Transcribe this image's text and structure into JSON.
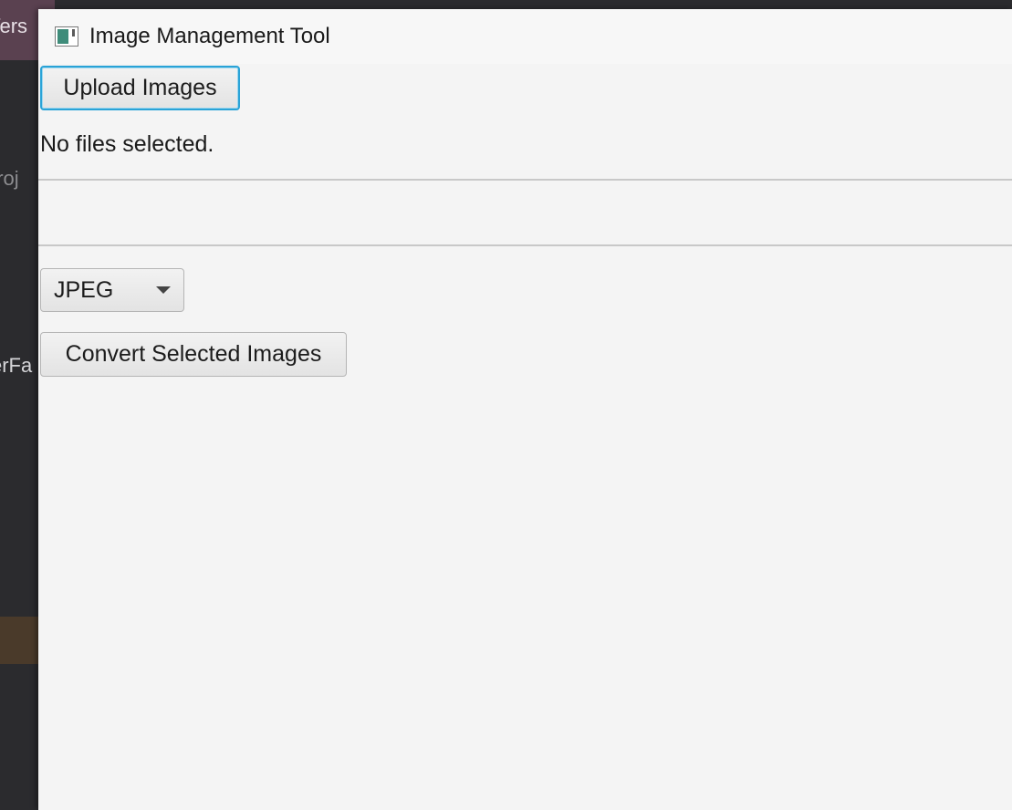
{
  "background_app": {
    "fragments": [
      "Vers",
      "proj",
      "erFa",
      "r"
    ]
  },
  "window": {
    "title": "Image Management Tool",
    "icon": "app-window-icon"
  },
  "main": {
    "upload_button_label": "Upload Images",
    "status_text": "No files selected.",
    "file_list_items": [],
    "format_select": {
      "selected": "JPEG"
    },
    "convert_button_label": "Convert Selected Images"
  },
  "colors": {
    "focus_ring": "#2aa3d7",
    "window_bg": "#f4f4f4",
    "background_titlebar": "#5a4150"
  }
}
